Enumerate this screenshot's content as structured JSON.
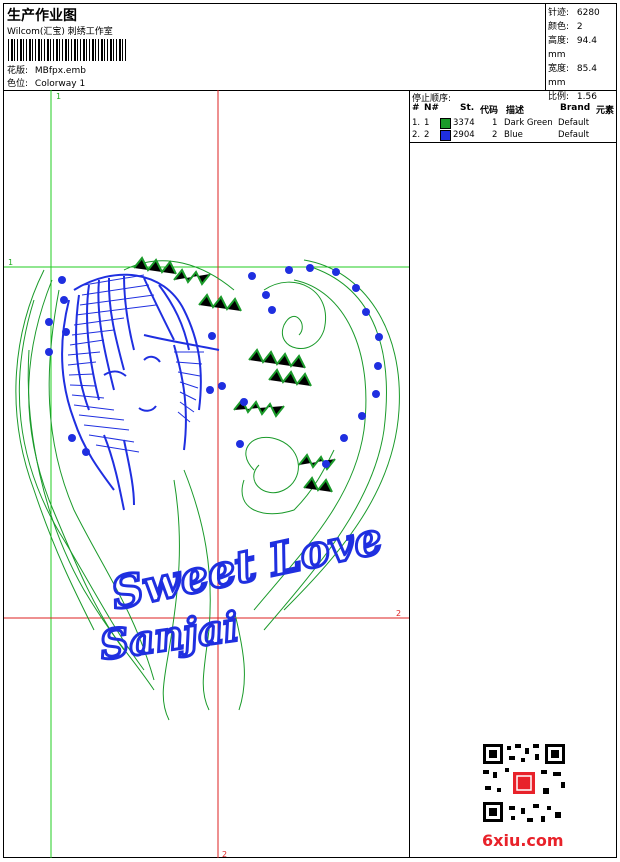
{
  "header": {
    "title": "生产作业图",
    "company": "Wilcom(汇宝) 刺绣工作室",
    "design_label": "花版:",
    "design_value": "MBfpx.emb",
    "colorway_label": "色位:",
    "colorway_value": "Colorway 1"
  },
  "stats": [
    {
      "label": "针迹:",
      "value": "6280"
    },
    {
      "label": "颜色:",
      "value": "2"
    },
    {
      "label": "高度:",
      "value": "94.4 mm"
    },
    {
      "label": "宽度:",
      "value": "85.4 mm"
    },
    {
      "label": "比例:",
      "value": "1.56"
    }
  ],
  "stop_sequence": {
    "title": "停止顺序:",
    "columns": [
      "#",
      "N#",
      "St.",
      "代码",
      "描述",
      "Brand",
      "元素"
    ],
    "rows": [
      {
        "index": "1.",
        "needle": "1",
        "stitches": "3374",
        "code": "1",
        "description": "Dark Green",
        "brand": "Default",
        "color": "#1a9a2a"
      },
      {
        "index": "2.",
        "needle": "2",
        "stitches": "2904",
        "code": "2",
        "description": "Blue",
        "brand": "Default",
        "color": "#1f2fe0"
      }
    ]
  },
  "guides": {
    "v1": "1",
    "h1": "1",
    "h2": "2",
    "v2": "2"
  },
  "artwork": {
    "text_line1": "Sweet Love",
    "text_line2": "Sanjai"
  },
  "watermark": "6xiu.com"
}
